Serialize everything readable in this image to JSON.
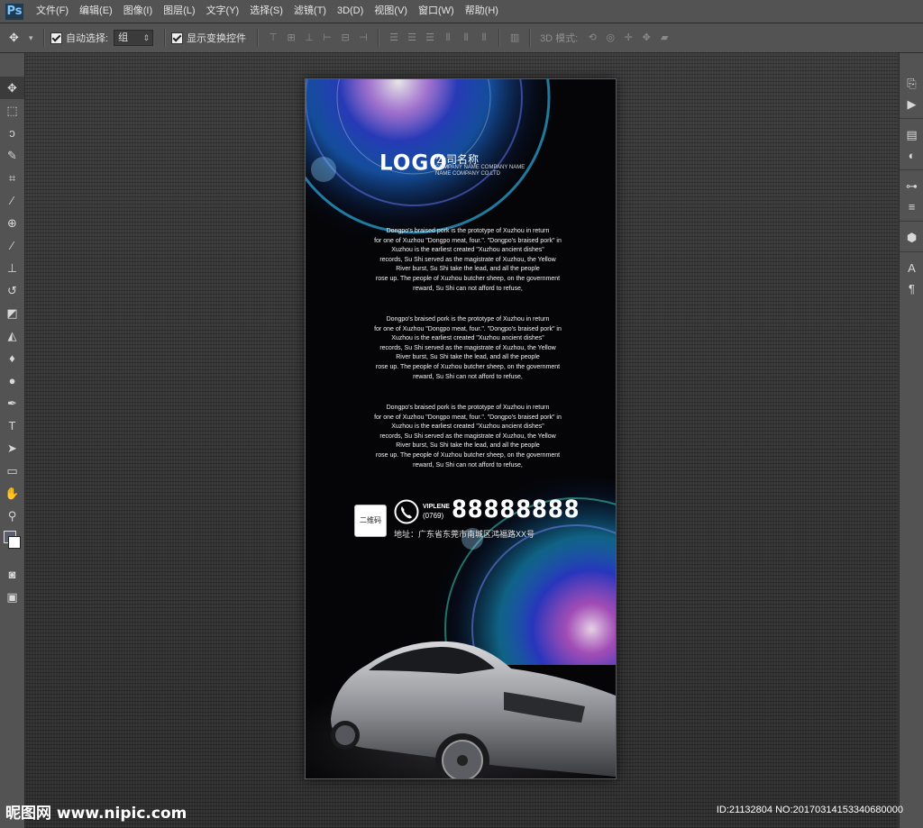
{
  "app": {
    "logo": "Ps"
  },
  "menu": [
    "文件(F)",
    "编辑(E)",
    "图像(I)",
    "图层(L)",
    "文字(Y)",
    "选择(S)",
    "滤镜(T)",
    "3D(D)",
    "视图(V)",
    "窗口(W)",
    "帮助(H)"
  ],
  "options": {
    "auto_select_label": "自动选择:",
    "auto_select_value": "组",
    "show_transform_label": "显示变换控件",
    "mode3d_label": "3D 模式:"
  },
  "tools": [
    "move-tool-icon",
    "marquee-tool-icon",
    "lasso-tool-icon",
    "quick-select-tool-icon",
    "crop-tool-icon",
    "eyedropper-tool-icon",
    "healing-brush-icon",
    "brush-tool-icon",
    "clone-stamp-icon",
    "history-brush-icon",
    "eraser-tool-icon",
    "paint-bucket-icon",
    "blur-tool-icon",
    "dodge-tool-icon",
    "pen-tool-icon",
    "type-tool-icon",
    "path-select-icon",
    "rectangle-tool-icon",
    "hand-tool-icon",
    "zoom-tool-icon"
  ],
  "poster": {
    "logo": "LOGO",
    "company_cn": "公司名称",
    "company_en_line1": "COMPANY NAME COMPANY NAME",
    "company_en_line2": "NAME COMPANY CO.LTD",
    "paragraph_lines": [
      "Dongpo's braised pork is the prototype of Xuzhou in return",
      "for one of Xuzhou \"Dongpo meat, four.\". \"Dongpo's braised pork\" in",
      "Xuzhou is the earliest created \"Xuzhou ancient dishes\"",
      "records, Su Shi served as the magistrate of Xuzhou, the Yellow",
      "River burst, Su Shi take the lead, and all the people",
      "rose up. The people of Xuzhou butcher sheep, on the government",
      "reward, Su Shi can not afford to refuse,"
    ],
    "qr_label": "二维码",
    "vip_label": "VIPLENE",
    "area_code": "(0769)",
    "phone": "88888888",
    "address": "地址：广东省东莞市南城区鸿福路XX号"
  },
  "watermark": {
    "left": "昵图网 www.nipic.com",
    "right": "ID:21132804 NO:20170314153340680000"
  },
  "colors": {
    "ui_panel": "#535353",
    "workspace": "#333333",
    "poster_bg": "#050507",
    "lens_blue": "#1e4bd6",
    "lens_purple": "#7a3fe0",
    "lens_cyan": "#2fc7ff"
  }
}
